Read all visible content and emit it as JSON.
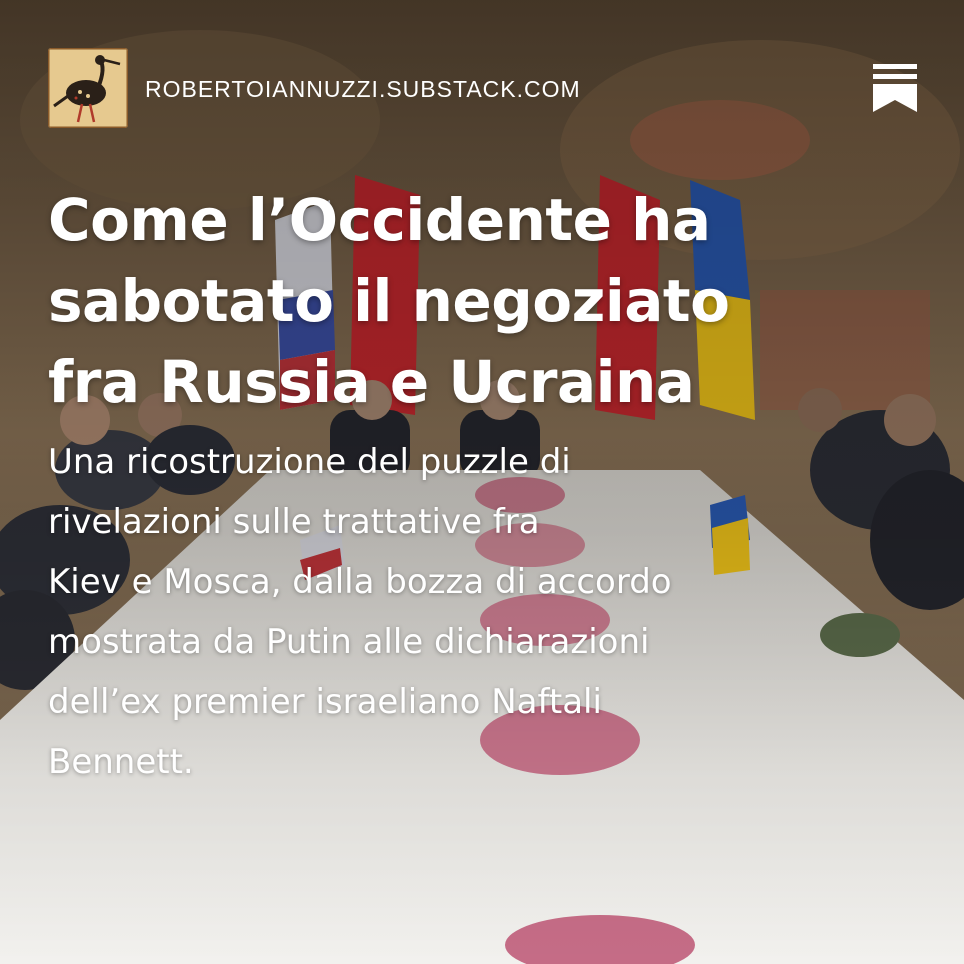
{
  "header": {
    "publication_domain": "ROBERTOIANNUZZI.SUBSTACK.COM",
    "logo_icon": "heron-bird-icon",
    "brand_icon": "substack-bookmark-icon"
  },
  "article": {
    "title_lines": [
      "Come l’Occidente ha",
      "sabotato il negoziato",
      "fra Russia e Ucraina"
    ],
    "subtitle_lines": [
      "Una ricostruzione del puzzle di",
      "rivelazioni sulle trattative fra",
      "Kiev e Mosca, dalla bozza di accordo",
      "mostrata da Putin alle dichiarazioni",
      "dell’ex premier israeliano Naftali",
      "Bennett."
    ]
  },
  "colors": {
    "text": "#ffffff",
    "substack_icon": "#ffffff"
  }
}
